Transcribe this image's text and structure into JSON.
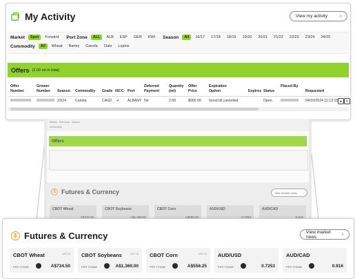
{
  "activity": {
    "title": "My Activity",
    "view_button": "View my activity",
    "filters": {
      "market_label": "Market",
      "market_options": [
        "Spot",
        "Forward"
      ],
      "port_zone_label": "Port Zone",
      "port_zone_options": [
        "ALL",
        "ALB",
        "ESP",
        "GER",
        "KWI"
      ],
      "season_label": "Season",
      "season_options": [
        "All",
        "16/17",
        "17/18",
        "18/19",
        "19/20",
        "20/21",
        "21/22",
        "22/23",
        "23/24",
        "24/25"
      ],
      "commodity_label": "Commodity",
      "commodity_options": [
        "All",
        "Wheat",
        "Barley",
        "Canola",
        "Oats",
        "Lupins"
      ]
    },
    "offers": {
      "title": "Offers",
      "subtitle": "(2.00 mt in total)",
      "columns": [
        "Offer Number",
        "Grower Number",
        "Season",
        "Commodity",
        "Grade",
        "ISCC",
        "Port",
        "Deferred Payment",
        "Quantity (mt)",
        "Offer Price",
        "Expiration Option",
        "Expires",
        "Status",
        "Placed By",
        "Requested"
      ],
      "row": {
        "season": "23/24",
        "commodity": "Canola",
        "grade": "CAG2",
        "iscc": "✔",
        "port": "ALBANY",
        "deferred": "No",
        "quantity": "2.00",
        "price": "$900.00",
        "expiration": "Good till cancelled",
        "status": "Open",
        "requested": "04/10/2024 11:13:15"
      }
    }
  },
  "futures": {
    "title": "Futures & Currency",
    "view_button": "View market news",
    "coin_icon": "$",
    "tiles": [
      {
        "name": "CBOT Wheat",
        "code": "DEP 25",
        "unit": "PER TONNE",
        "value": "A$734.50"
      },
      {
        "name": "CBOT Soybeans",
        "code": "DEP 25",
        "unit": "PER TONNE",
        "value": "A$1,369.00"
      },
      {
        "name": "CBOT Corn",
        "code": "DEP 25",
        "unit": "PER TONNE",
        "value": "A$558.25"
      },
      {
        "name": "AUD/USD",
        "code": "",
        "unit": "PER TONNE",
        "value": "0.7253"
      },
      {
        "name": "AUD/CAD",
        "code": "",
        "unit": "PER TONNE",
        "value": "0.916"
      }
    ]
  },
  "colors": {
    "accent": "#90d32c",
    "coin": "#f0a500"
  },
  "icons": {
    "activity": "activity-icon",
    "arrow": "chevron-right-icon",
    "coin": "dollar-coin-icon"
  }
}
